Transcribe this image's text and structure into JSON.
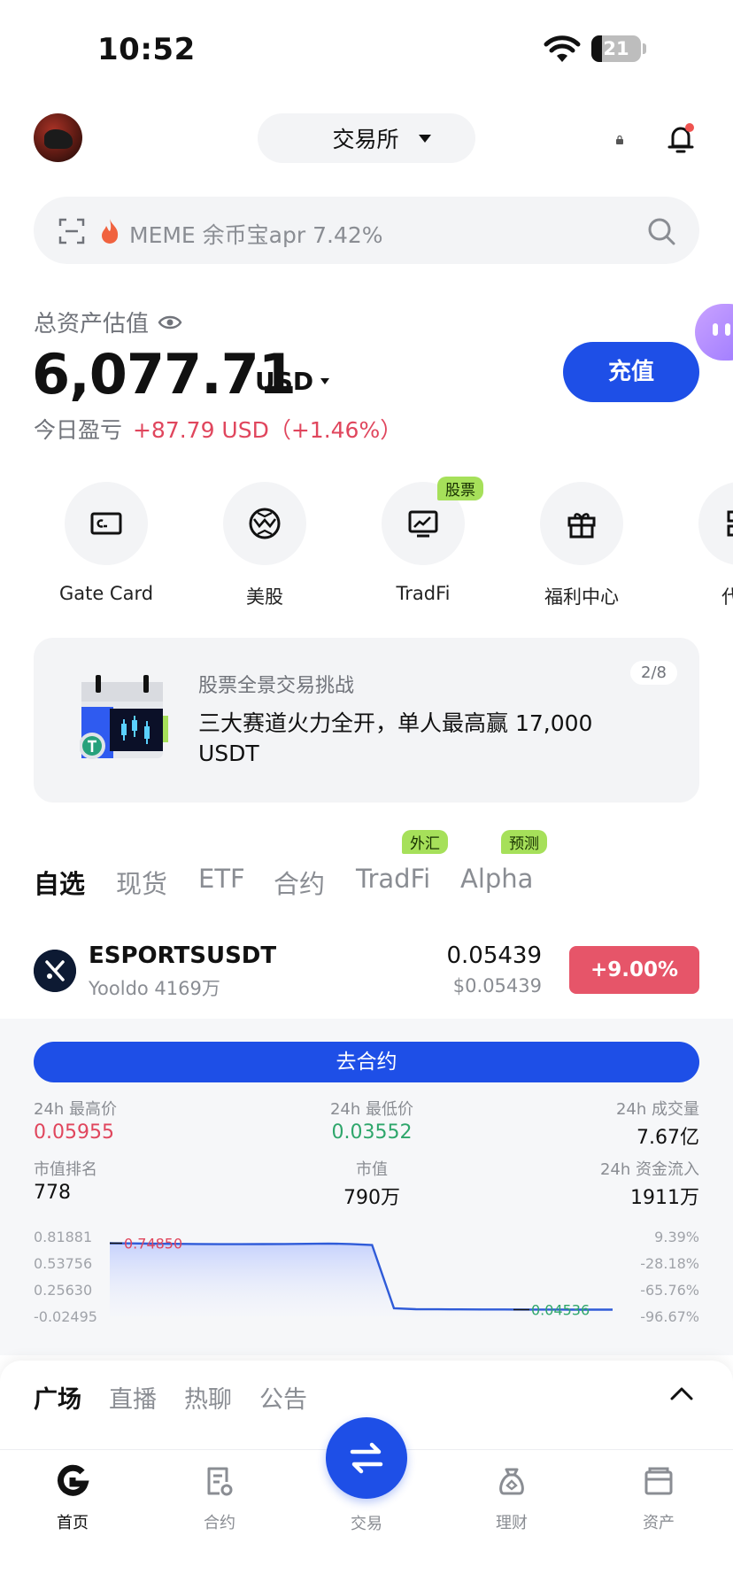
{
  "status_bar": {
    "time": "10:52",
    "battery": "21"
  },
  "header": {
    "exchange_label": "交易所"
  },
  "search": {
    "placeholder": "MEME 余币宝apr 7.42%"
  },
  "assets": {
    "label": "总资产估值",
    "value": "6,077.71",
    "unit": "USD",
    "pnl_label": "今日盈亏",
    "pnl_value": "+87.79 USD（+1.46%）",
    "deposit_label": "充值"
  },
  "quick_entries": [
    {
      "label": "Gate Card",
      "icon": "card-icon"
    },
    {
      "label": "美股",
      "icon": "globe-icon"
    },
    {
      "label": "TradFi",
      "icon": "chart-board-icon",
      "badge": "股票"
    },
    {
      "label": "福利中心",
      "icon": "gift-icon"
    },
    {
      "label": "代币",
      "icon": "grid-icon"
    }
  ],
  "banner": {
    "subtitle": "股票全景交易挑战",
    "title": "三大赛道火力全开，单人最高赢 17,000 USDT",
    "page": "2/8"
  },
  "market_tabs": [
    {
      "label": "自选",
      "active": true
    },
    {
      "label": "现货"
    },
    {
      "label": "ETF"
    },
    {
      "label": "合约"
    },
    {
      "label": "TradFi",
      "badge": "外汇"
    },
    {
      "label": "Alpha",
      "badge": "预测"
    }
  ],
  "market_row": {
    "symbol": "ESPORTSUSDT",
    "sub": "Yooldo 4169万",
    "price": "0.05439",
    "price_usd": "$0.05439",
    "change": "+9.00%"
  },
  "detail": {
    "go_contract": "去合约",
    "stats": [
      {
        "label": "24h 最高价",
        "value": "0.05955",
        "tone": "red"
      },
      {
        "label": "24h 最低价",
        "value": "0.03552",
        "tone": "green"
      },
      {
        "label": "24h 成交量",
        "value": "7.67亿"
      },
      {
        "label": "市值排名",
        "value": "778"
      },
      {
        "label": "市值",
        "value": "790万"
      },
      {
        "label": "24h 资金流入",
        "value": "1911万"
      }
    ]
  },
  "chart_data": {
    "type": "line",
    "y_left_ticks": [
      "0.81881",
      "0.53756",
      "0.25630",
      "-0.02495"
    ],
    "y_right_ticks": [
      "9.39%",
      "-28.18%",
      "-65.76%",
      "-96.67%"
    ],
    "ylim": [
      -0.02495,
      0.81881
    ],
    "high_label": "0.74850",
    "low_label": "0.04536",
    "values": [
      0.7485,
      0.747,
      0.744,
      0.742,
      0.74,
      0.738,
      0.7385,
      0.739,
      0.74,
      0.742,
      0.745,
      0.74,
      0.73,
      0.06,
      0.05,
      0.049,
      0.048,
      0.0475,
      0.047,
      0.0465,
      0.046,
      0.0458,
      0.0455,
      0.04536
    ]
  },
  "feed_tabs": [
    {
      "label": "广场",
      "active": true
    },
    {
      "label": "直播"
    },
    {
      "label": "热聊"
    },
    {
      "label": "公告"
    }
  ],
  "bottom_nav": [
    {
      "label": "首页",
      "active": true
    },
    {
      "label": "合约"
    },
    {
      "label": "交易"
    },
    {
      "label": "理财"
    },
    {
      "label": "资产"
    }
  ]
}
